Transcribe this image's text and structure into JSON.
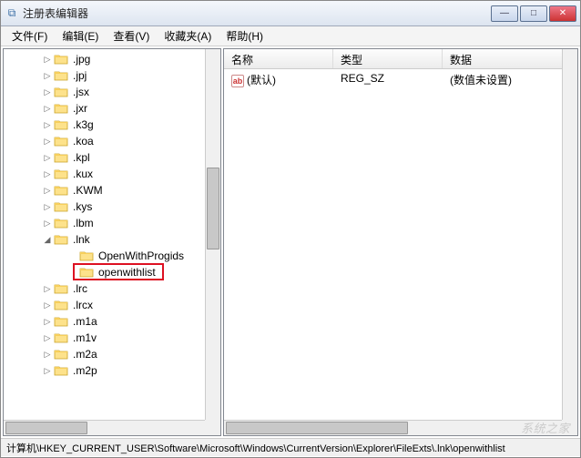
{
  "window": {
    "title": "注册表编辑器"
  },
  "menu": {
    "file": "文件(F)",
    "edit": "编辑(E)",
    "view": "查看(V)",
    "favorites": "收藏夹(A)",
    "help": "帮助(H)"
  },
  "tree": {
    "items": [
      {
        "label": ".jpg",
        "depth": 2,
        "expandable": true
      },
      {
        "label": ".jpj",
        "depth": 2,
        "expandable": true
      },
      {
        "label": ".jsx",
        "depth": 2,
        "expandable": true
      },
      {
        "label": ".jxr",
        "depth": 2,
        "expandable": true
      },
      {
        "label": ".k3g",
        "depth": 2,
        "expandable": true
      },
      {
        "label": ".koa",
        "depth": 2,
        "expandable": true
      },
      {
        "label": ".kpl",
        "depth": 2,
        "expandable": true
      },
      {
        "label": ".kux",
        "depth": 2,
        "expandable": true
      },
      {
        "label": ".KWM",
        "depth": 2,
        "expandable": true
      },
      {
        "label": ".kys",
        "depth": 2,
        "expandable": true
      },
      {
        "label": ".lbm",
        "depth": 2,
        "expandable": true
      },
      {
        "label": ".lnk",
        "depth": 2,
        "expandable": true,
        "expanded": true
      },
      {
        "label": "OpenWithProgids",
        "depth": 3,
        "expandable": false
      },
      {
        "label": "openwithlist",
        "depth": 3,
        "expandable": false,
        "highlighted": true
      },
      {
        "label": ".lrc",
        "depth": 2,
        "expandable": true
      },
      {
        "label": ".lrcx",
        "depth": 2,
        "expandable": true
      },
      {
        "label": ".m1a",
        "depth": 2,
        "expandable": true
      },
      {
        "label": ".m1v",
        "depth": 2,
        "expandable": true
      },
      {
        "label": ".m2a",
        "depth": 2,
        "expandable": true
      },
      {
        "label": ".m2p",
        "depth": 2,
        "expandable": true
      }
    ]
  },
  "list": {
    "columns": {
      "name": "名称",
      "type": "类型",
      "data": "数据"
    },
    "rows": [
      {
        "name": "(默认)",
        "type": "REG_SZ",
        "data": "(数值未设置)"
      }
    ]
  },
  "statusbar": "计算机\\HKEY_CURRENT_USER\\Software\\Microsoft\\Windows\\CurrentVersion\\Explorer\\FileExts\\.lnk\\openwithlist",
  "watermark": "系统之家"
}
